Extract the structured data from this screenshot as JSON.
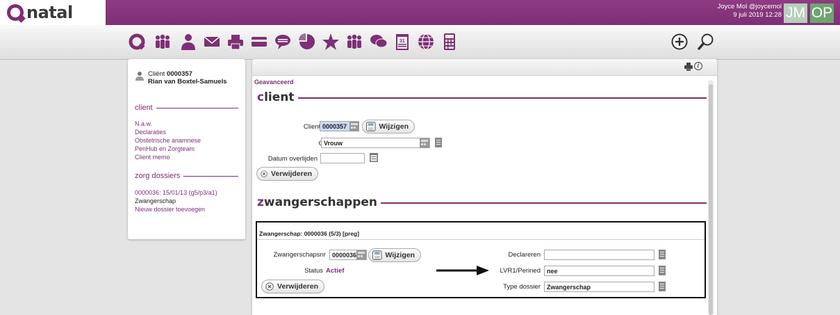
{
  "app": {
    "logo_text": "natal"
  },
  "user": {
    "name": "Joyce Mol @joycemol",
    "datetime": "9 juli 2019 12:28"
  },
  "avatars": [
    "JM",
    "OP"
  ],
  "colors": {
    "brand": "#7e2f75",
    "avatar_jm": "#b8cfbb",
    "avatar_op": "#6ea56f"
  },
  "toolbar": {
    "icons": [
      "onatal-home-icon",
      "team-icon",
      "client-icon",
      "mail-icon",
      "print-icon",
      "card-icon",
      "chat-icon",
      "chart-icon",
      "star-icon",
      "group-icon",
      "messages-icon",
      "calendar-icon",
      "globe-icon",
      "calculator-icon"
    ],
    "right_icons": [
      "add-icon",
      "search-icon"
    ]
  },
  "sidebar": {
    "client_label": "Cliënt",
    "client_number": "0000357",
    "client_name": "Rian van Boxtel-Samuels",
    "section_client": "client",
    "client_links": [
      "N.a.w.",
      "Declaraties",
      "Obstetrische anamnese",
      "PeriHub en Zorgteam",
      "Client memo"
    ],
    "section_dossiers": "zorg dossiers",
    "dossier_link": "0000036: 15/01/13 (g5/p3/a1)",
    "dossier_type": "Zwangerschap",
    "new_dossier_link": "Nieuw dossier toevoegen"
  },
  "main": {
    "breadcrumb": "Geavanceerd",
    "client_section": {
      "title_first": "c",
      "title_rest": "lient",
      "clientnummer_label": "Clientnummer",
      "clientnummer_value": "0000357",
      "wijzigen_label": "Wijzigen",
      "geslacht_label": "Geslacht",
      "geslacht_value": "Vrouw",
      "datum_label": "Datum overlijden",
      "datum_value": "",
      "verwijderen_label": "Verwijderen"
    },
    "preg_section": {
      "title_first": "z",
      "title_rest": "wangerschappen",
      "box_title": "Zwangerschap: 0000036 (5/3) [preg]",
      "nr_label": "Zwangerschapsnr",
      "nr_value": "0000036",
      "wijzigen_label": "Wijzigen",
      "status_label": "Status",
      "status_value": "Actief",
      "verwijderen_label": "Verwijderen",
      "declareren_label": "Declareren",
      "declareren_value": "",
      "lvr_label": "LVR1/Perined",
      "lvr_value": "nee",
      "type_label": "Type dossier",
      "type_value": "Zwangerschap"
    }
  }
}
